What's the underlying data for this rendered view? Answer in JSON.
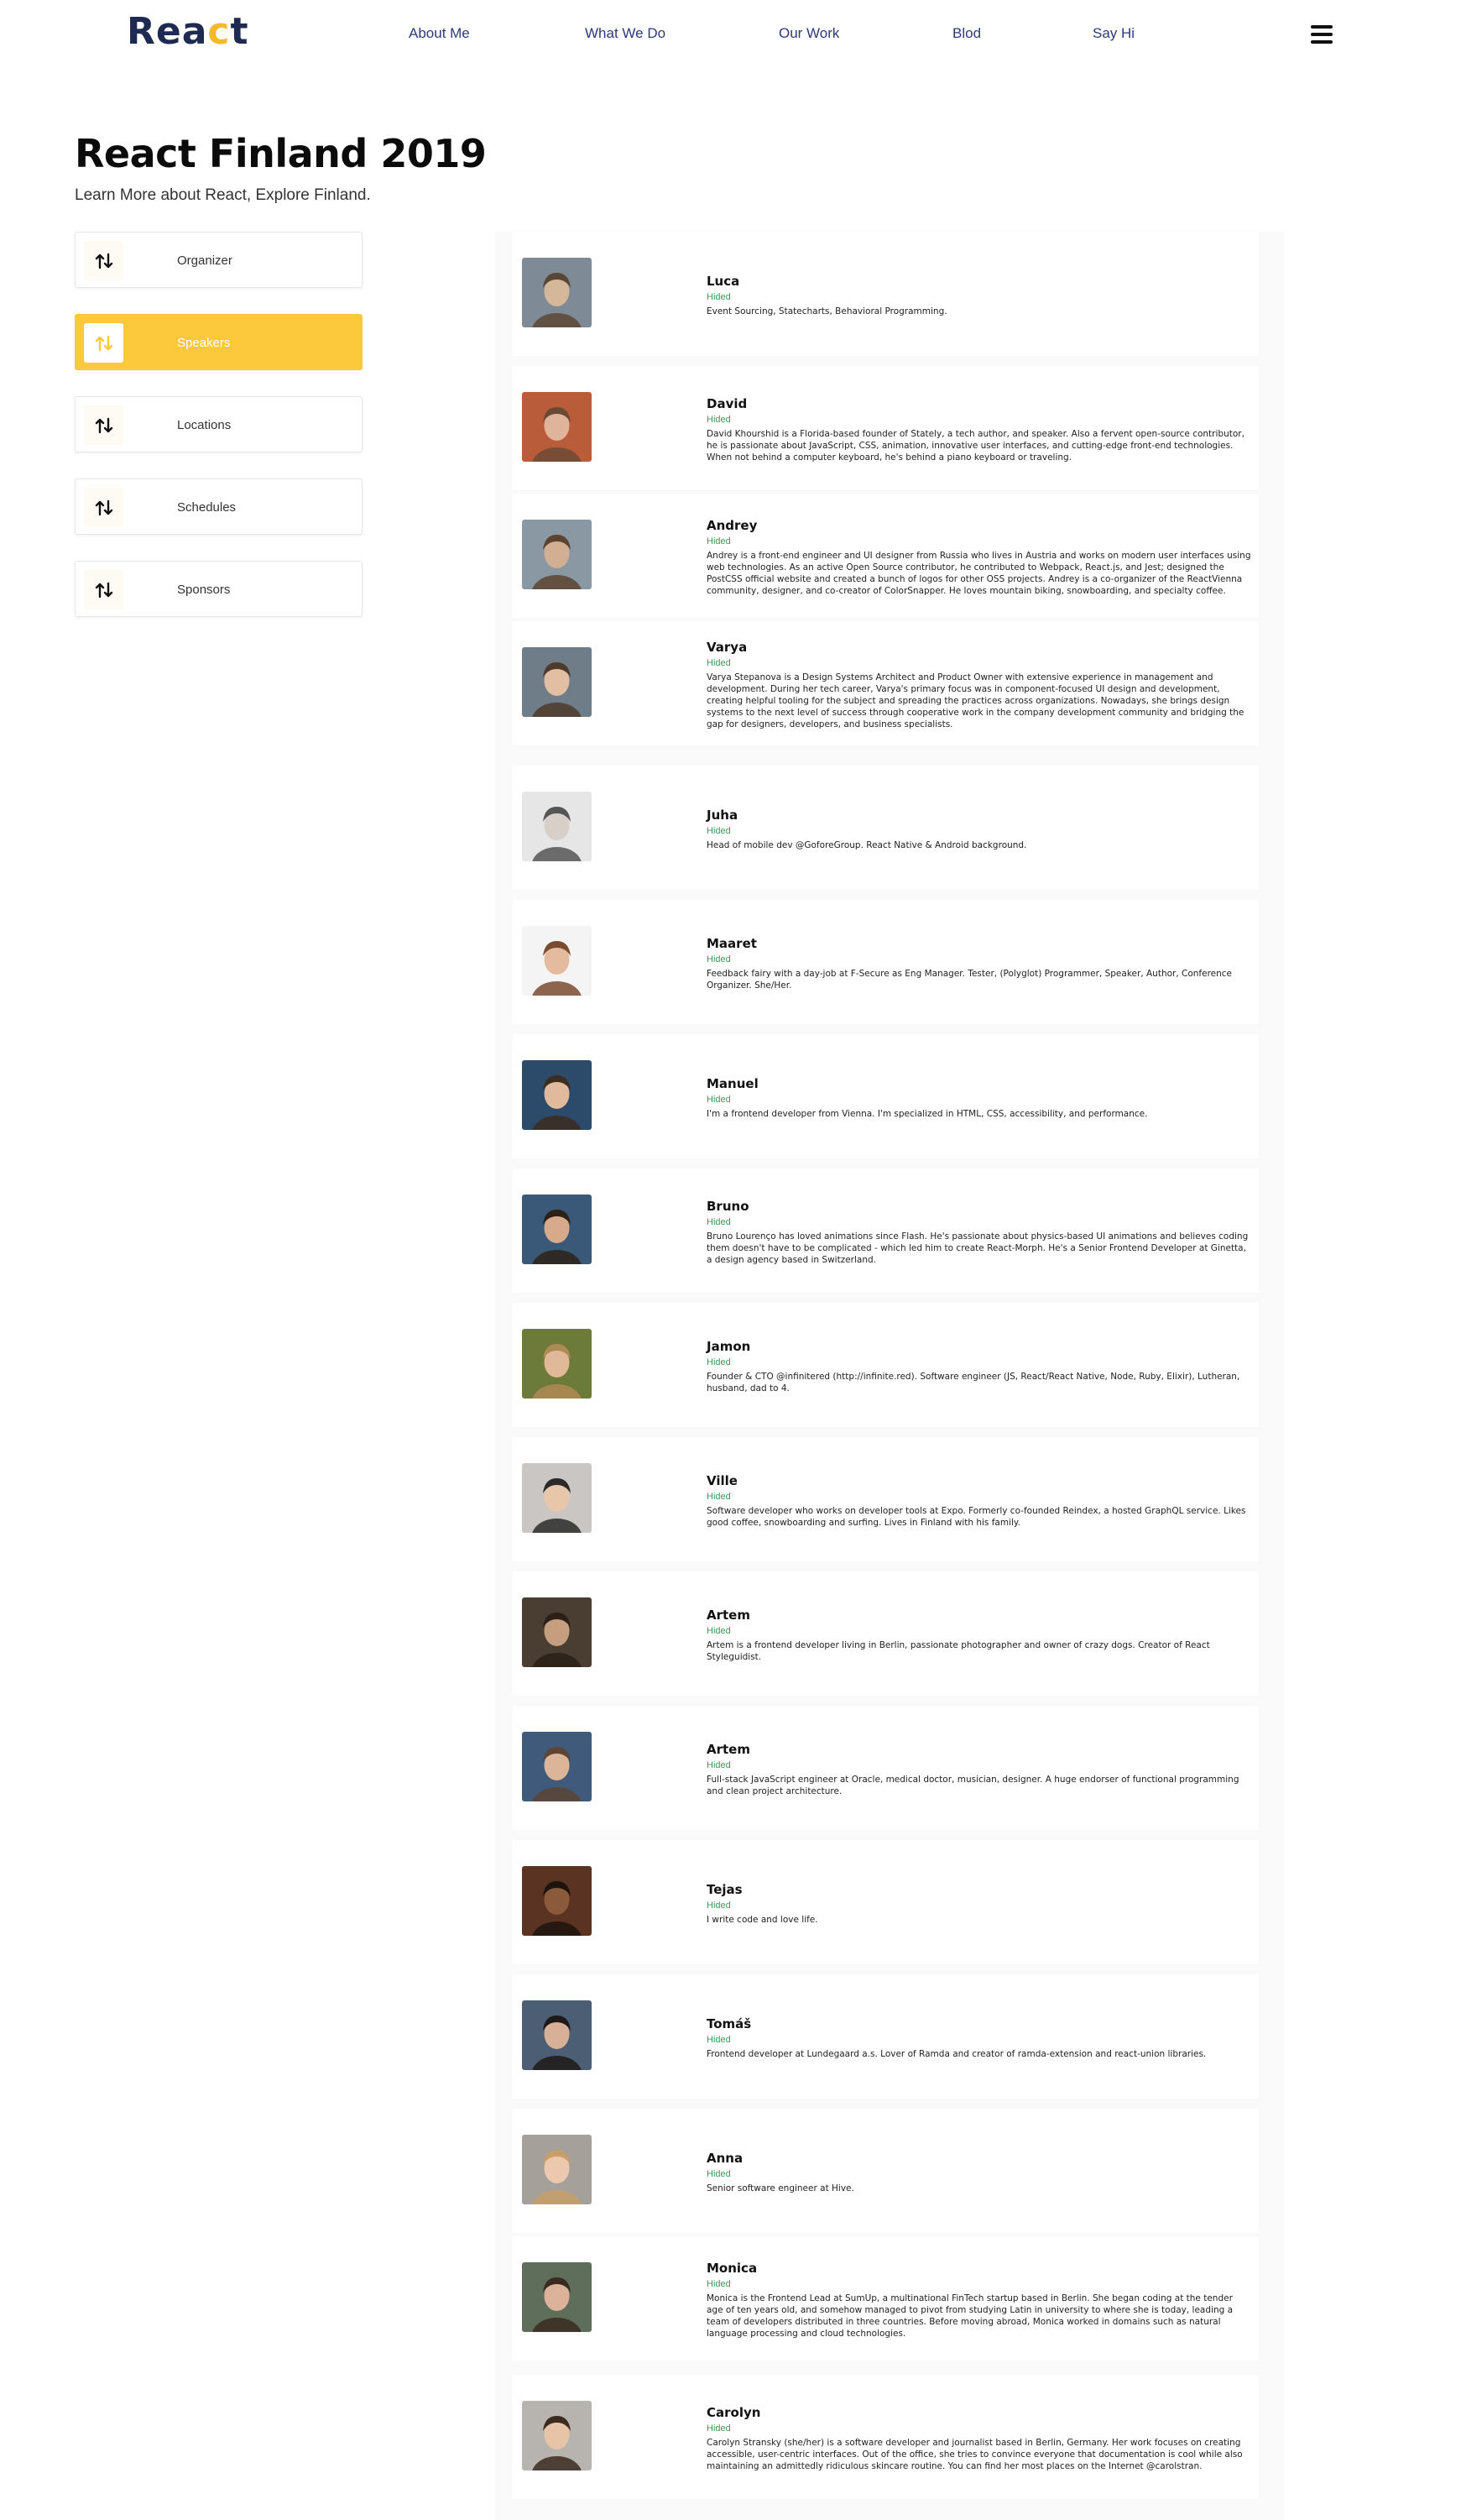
{
  "header": {
    "logo_main": "Rea",
    "logo_accent": "c",
    "logo_end": "t",
    "nav": [
      "About Me",
      "What We Do",
      "Our Work",
      "Blod",
      "Say Hi"
    ],
    "menu_icon": "hamburger-icon"
  },
  "page": {
    "title": "React Finland 2019",
    "subtitle": "Learn More about React, Explore Finland."
  },
  "sidebar": {
    "items": [
      {
        "label": "Organizer",
        "icon": "sort-arrows-icon",
        "active": false
      },
      {
        "label": "Speakers",
        "icon": "sort-arrows-icon",
        "active": true
      },
      {
        "label": "Locations",
        "icon": "sort-arrows-icon",
        "active": false
      },
      {
        "label": "Schedules",
        "icon": "sort-arrows-icon",
        "active": false
      },
      {
        "label": "Sponsors",
        "icon": "sort-arrows-icon",
        "active": false
      }
    ],
    "accent_color": "#fdc93c"
  },
  "speakers": [
    {
      "name": "Luca",
      "status": "Hided",
      "bio": [
        "Event Sourcing, Statecharts, Behavioral Programming."
      ]
    },
    {
      "name": "David",
      "status": "Hided",
      "bio": [
        "David Khourshid is a Florida-based founder of Stately, a tech author, and speaker. Also a fervent open-source contributor,",
        "he is passionate about JavaScript, CSS, animation, innovative user interfaces, and cutting-edge front-end technologies.",
        "When not behind a computer keyboard, he's behind a piano keyboard or traveling."
      ]
    },
    {
      "name": "Andrey",
      "status": "Hided",
      "bio": [
        "Andrey is a front-end engineer and UI designer from Russia who lives in Austria and works on modern user interfaces using",
        "web technologies. As an active Open Source contributor, he contributed to Webpack, React.js, and Jest; designed the",
        "PostCSS official website and created a bunch of logos for other OSS projects. Andrey is a co-organizer of the ReactVienna",
        "community, designer, and co-creator of ColorSnapper. He loves mountain biking, snowboarding, and specialty coffee."
      ]
    },
    {
      "name": "Varya",
      "status": "Hided",
      "bio": [
        "Varya Stepanova is a Design Systems Architect and Product Owner with extensive experience in management and",
        "development. During her tech career, Varya's primary focus was in component-focused UI design and development,",
        "creating helpful tooling for the subject and spreading the practices across organizations. Nowadays, she brings design",
        "systems to the next level of success through cooperative work in the company development community and bridging the",
        "gap for designers, developers, and business specialists."
      ]
    },
    {
      "name": "Juha",
      "status": "Hided",
      "bio": [
        "Head of mobile dev @GoforeGroup. React Native & Android background."
      ]
    },
    {
      "name": "Maaret",
      "status": "Hided",
      "bio": [
        "Feedback fairy with a day-job at F-Secure as Eng Manager. Tester, (Polyglot) Programmer, Speaker, Author, Conference",
        "Organizer. She/Her."
      ]
    },
    {
      "name": "Manuel",
      "status": "Hided",
      "bio": [
        "I'm a frontend developer from Vienna. I'm specialized in HTML, CSS, accessibility, and performance."
      ]
    },
    {
      "name": "Bruno",
      "status": "Hided",
      "bio": [
        "Bruno Lourenço has loved animations since Flash. He's passionate about physics-based UI animations and believes coding",
        "them doesn't have to be complicated - which led him to create React-Morph. He's a Senior Frontend Developer at Ginetta,",
        "a design agency based in Switzerland."
      ]
    },
    {
      "name": "Jamon",
      "status": "Hided",
      "bio": [
        "Founder & CTO @infinitered (http://infinite.red). Software engineer (JS, React/React Native, Node, Ruby, Elixir), Lutheran,",
        "husband, dad to 4."
      ]
    },
    {
      "name": "Ville",
      "status": "Hided",
      "bio": [
        "Software developer who works on developer tools at Expo. Formerly co-founded Reindex, a hosted GraphQL service. Likes",
        "good coffee, snowboarding and surfing. Lives in Finland with his family."
      ]
    },
    {
      "name": "Artem",
      "status": "Hided",
      "bio": [
        "Artem is a frontend developer living in Berlin, passionate photographer and owner of crazy dogs. Creator of React",
        "Styleguidist."
      ]
    },
    {
      "name": "Artem",
      "status": "Hided",
      "bio": [
        "Full-stack JavaScript engineer at Oracle, medical doctor, musician, designer. A huge endorser of functional programming",
        "and clean project architecture."
      ]
    },
    {
      "name": "Tejas",
      "status": "Hided",
      "bio": [
        "I write code and love life."
      ]
    },
    {
      "name": "Tomáš",
      "status": "Hided",
      "bio": [
        "Frontend developer at Lundegaard a.s. Lover of Ramda and creator of ramda-extension and react-union libraries."
      ]
    },
    {
      "name": "Anna",
      "status": "Hided",
      "bio": [
        "Senior software engineer at Hive."
      ]
    },
    {
      "name": "Monica",
      "status": "Hided",
      "bio": [
        "Monica is the Frontend Lead at SumUp, a multinational FinTech startup based in Berlin. She began coding at the tender",
        "age of ten years old, and somehow managed to pivot from studying Latin in university to where she is today, leading a",
        "team of developers distributed in three countries. Before moving abroad, Monica worked in domains such as natural",
        "language processing and cloud technologies."
      ]
    },
    {
      "name": "Carolyn",
      "status": "Hided",
      "bio": [
        "Carolyn Stransky (she/her) is a software developer and journalist based in Berlin, Germany. Her work focuses on creating",
        "accessible, user-centric interfaces. Out of the office, she tries to convince everyone that documentation is cool while also",
        "maintaining an admittedly ridiculous skincare routine. You can find her most places on the Internet @carolstran."
      ]
    }
  ]
}
